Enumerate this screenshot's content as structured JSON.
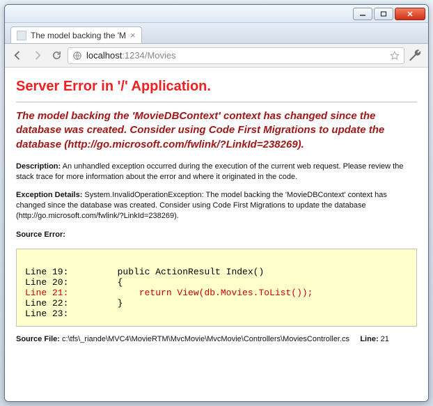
{
  "window": {
    "min": "–",
    "max": "❐",
    "close": "✕"
  },
  "tab": {
    "title": "The model backing the 'M",
    "close": "×"
  },
  "nav": {
    "url_host": "localhost",
    "url_rest": ":1234/Movies"
  },
  "page": {
    "title": "Server Error in '/' Application.",
    "subtitle": "The model backing the 'MovieDBContext' context has changed since the database was created. Consider using Code First Migrations to update the database (http://go.microsoft.com/fwlink/?LinkId=238269).",
    "description_label": "Description:",
    "description_text": "An unhandled exception occurred during the execution of the current web request. Please review the stack trace for more information about the error and where it originated in the code.",
    "details_label": "Exception Details:",
    "details_text": "System.InvalidOperationException: The model backing the 'MovieDBContext' context has changed since the database was created. Consider using Code First Migrations to update the database (http://go.microsoft.com/fwlink/?LinkId=238269).",
    "source_error_label": "Source Error:",
    "code_plain_before": "\nLine 19:         public ActionResult Index()\nLine 20:         {\n",
    "code_highlight": "Line 21:             return View(db.Movies.ToList());\n",
    "code_plain_after": "Line 22:         }\nLine 23:\n",
    "source_file_label": "Source File:",
    "source_file_path": "c:\\tfs\\_riande\\MVC4\\MovieRTM\\MvcMovie\\MvcMovie\\Controllers\\MoviesController.cs",
    "line_label": "Line:",
    "line_number": "21"
  }
}
